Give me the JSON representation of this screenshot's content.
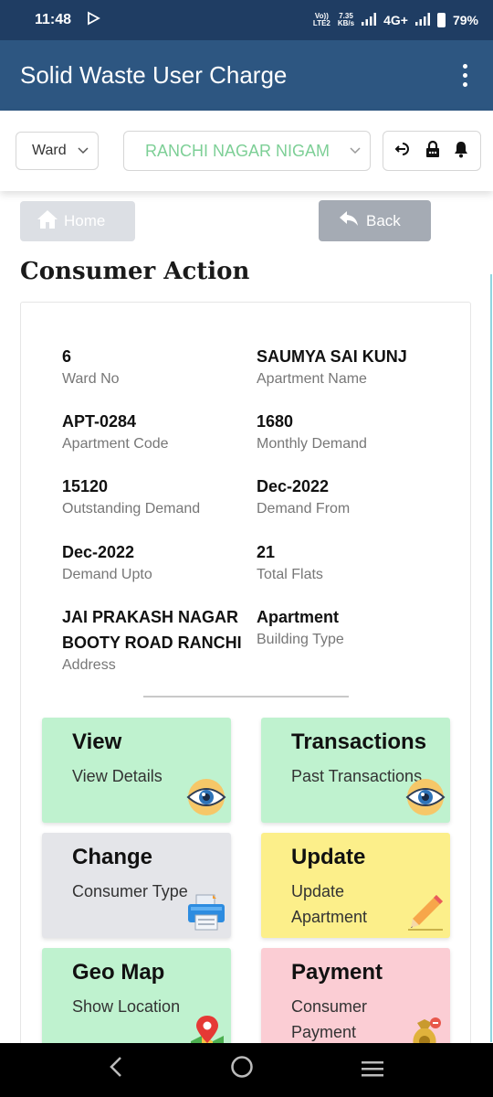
{
  "status_bar": {
    "time": "11:48",
    "volte": "Vo))",
    "lte": "LTE2",
    "speed_value": "7.35",
    "speed_unit": "KB/s",
    "network": "4G+",
    "battery": "79%"
  },
  "app_bar": {
    "title": "Solid Waste User Charge",
    "menu_icon": "more-vertical-icon"
  },
  "toolbar": {
    "ward_select": "Ward",
    "ulb_select": "RANCHI NAGAR NIGAM",
    "icons": [
      "logout-icon",
      "lock-icon",
      "bell-icon"
    ]
  },
  "nav_buttons": {
    "home_label": "Home",
    "back_label": "Back"
  },
  "page_title": "Consumer Action",
  "consumer": {
    "ward_no": {
      "value": "6",
      "label": "Ward No"
    },
    "apartment_name": {
      "value": "SAUMYA SAI KUNJ",
      "label": "Apartment Name"
    },
    "apartment_code": {
      "value": "APT-0284",
      "label": "Apartment Code"
    },
    "monthly_demand": {
      "value": "1680",
      "label": "Monthly Demand"
    },
    "outstanding_demand": {
      "value": "15120",
      "label": "Outstanding Demand"
    },
    "demand_from": {
      "value": "Dec-2022",
      "label": "Demand From"
    },
    "demand_upto": {
      "value": "Dec-2022",
      "label": "Demand Upto"
    },
    "total_flats": {
      "value": "21",
      "label": "Total Flats"
    },
    "address": {
      "value": "JAI PRAKASH NAGAR BOOTY ROAD RANCHI",
      "label": "Address"
    },
    "building_type": {
      "value": "Apartment",
      "label": "Building Type"
    }
  },
  "actions": {
    "view": {
      "title": "View",
      "subtitle": "View Details",
      "icon": "eye-icon"
    },
    "transactions": {
      "title": "Transactions",
      "subtitle": "Past Transactions",
      "icon": "eye-icon"
    },
    "change": {
      "title": "Change",
      "subtitle": "Consumer Type",
      "icon": "printer-icon"
    },
    "update": {
      "title": "Update",
      "subtitle": "Update Apartment",
      "icon": "pencil-icon"
    },
    "geo_map": {
      "title": "Geo Map",
      "subtitle": "Show Location",
      "icon": "map-pin-icon"
    },
    "payment": {
      "title": "Payment",
      "subtitle": "Consumer Payment",
      "icon": "money-bag-icon"
    }
  },
  "colors": {
    "status_bar": "#1f3d63",
    "app_bar": "#2d5681",
    "ulb_text": "#7dcf96",
    "tile_green": "#bff2cf",
    "tile_grey": "#e4e5e9",
    "tile_yellow": "#fcef8a",
    "tile_pink": "#fbcdd4"
  }
}
